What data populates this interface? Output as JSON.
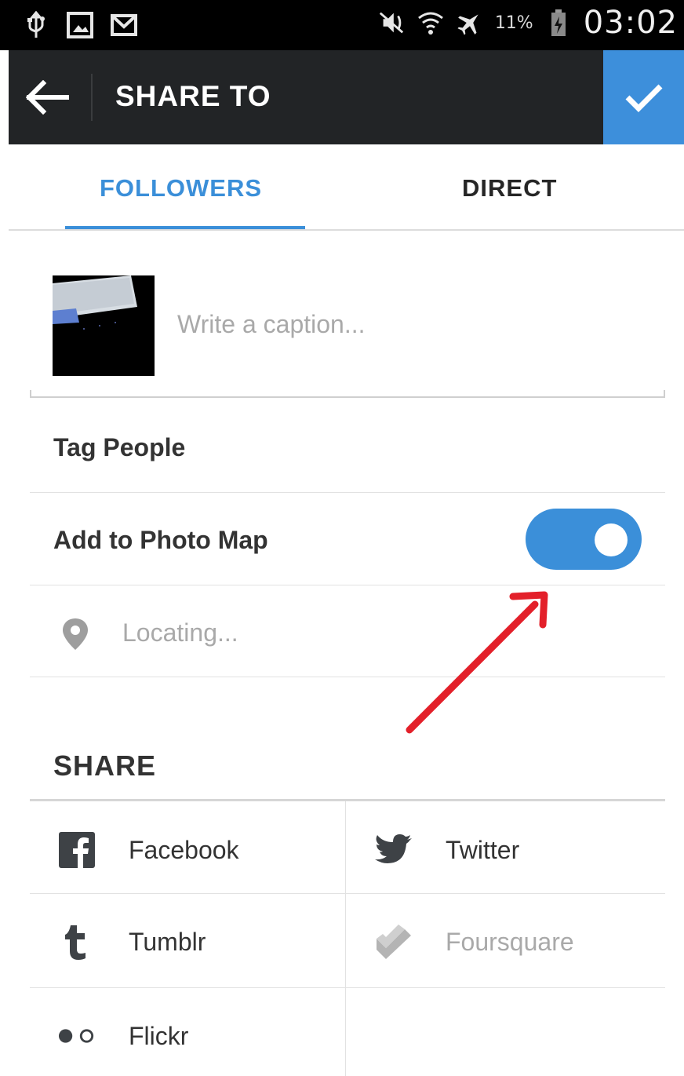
{
  "status_bar": {
    "battery_percent": "11%",
    "time": "03:02",
    "left_icons": [
      "usb-icon",
      "gallery-icon",
      "gmail-icon"
    ],
    "right_icons": [
      "mute-icon",
      "wifi-icon",
      "airplane-icon",
      "battery-icon"
    ]
  },
  "app_bar": {
    "title": "SHARE TO",
    "background": "#222426",
    "confirm_color": "#3d8fdb"
  },
  "tabs": [
    {
      "label": "FOLLOWERS",
      "active": true
    },
    {
      "label": "DIRECT",
      "active": false
    }
  ],
  "accent_color": "#3b8fd9",
  "caption": {
    "placeholder": "Write a caption..."
  },
  "rows": {
    "tag_people": "Tag People",
    "add_to_photo_map": "Add to Photo Map",
    "photo_map_enabled": true,
    "location_status": "Locating..."
  },
  "share": {
    "heading": "SHARE",
    "items": [
      {
        "label": "Facebook",
        "icon": "facebook-icon",
        "enabled": true
      },
      {
        "label": "Twitter",
        "icon": "twitter-icon",
        "enabled": true
      },
      {
        "label": "Tumblr",
        "icon": "tumblr-icon",
        "enabled": true
      },
      {
        "label": "Foursquare",
        "icon": "foursquare-icon",
        "enabled": false
      },
      {
        "label": "Flickr",
        "icon": "flickr-icon",
        "enabled": true
      }
    ]
  },
  "annotation_color": "#e3202a"
}
